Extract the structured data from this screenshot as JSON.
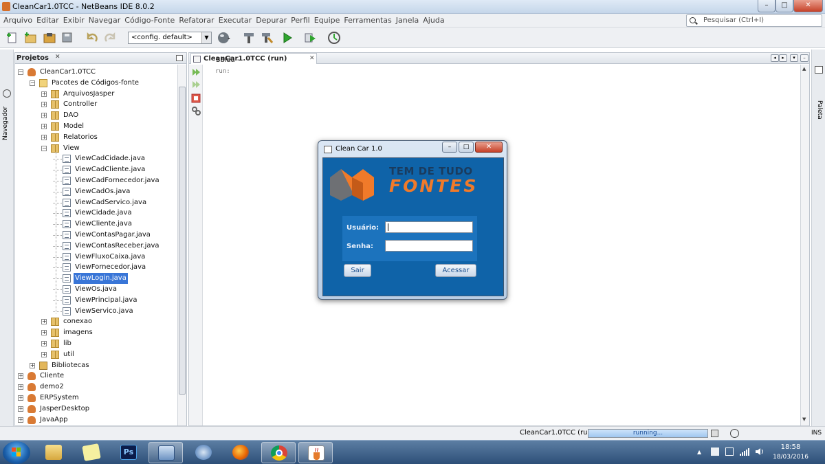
{
  "window": {
    "title": "CleanCar1.0TCC - NetBeans IDE 8.0.2",
    "controls": [
      "–",
      "□",
      "✕"
    ]
  },
  "menu": [
    "Arquivo",
    "Editar",
    "Exibir",
    "Navegar",
    "Código-Fonte",
    "Refatorar",
    "Executar",
    "Depurar",
    "Perfil",
    "Equipe",
    "Ferramentas",
    "Janela",
    "Ajuda"
  ],
  "search": {
    "placeholder": "Pesquisar (Ctrl+I)"
  },
  "toolbar": {
    "config_value": "<config. default>"
  },
  "left_strip": {
    "navegador_label": "Navegador"
  },
  "right_strip": {
    "paleta_label": "Paleta"
  },
  "projects_panel": {
    "tab_label": "Projetos",
    "tree": [
      {
        "label": "CleanCar1.0TCC",
        "icon": "project-icon",
        "expanded": true
      },
      {
        "label": "Pacotes de Códigos-fonte",
        "icon": "source-folder-icon",
        "expanded": true
      },
      {
        "label": "ArquivosJasper",
        "icon": "package-icon"
      },
      {
        "label": "Controller",
        "icon": "package-icon"
      },
      {
        "label": "DAO",
        "icon": "package-icon"
      },
      {
        "label": "Model",
        "icon": "package-icon"
      },
      {
        "label": "Relatorios",
        "icon": "package-icon"
      },
      {
        "label": "View",
        "icon": "package-icon",
        "expanded": true
      },
      {
        "label": "ViewCadCidade.java",
        "icon": "java-file-icon"
      },
      {
        "label": "ViewCadCliente.java",
        "icon": "java-file-icon"
      },
      {
        "label": "ViewCadFornecedor.java",
        "icon": "java-file-icon"
      },
      {
        "label": "ViewCadOs.java",
        "icon": "java-file-icon"
      },
      {
        "label": "ViewCadServico.java",
        "icon": "java-file-icon"
      },
      {
        "label": "ViewCidade.java",
        "icon": "java-file-icon"
      },
      {
        "label": "ViewCliente.java",
        "icon": "java-file-icon"
      },
      {
        "label": "ViewContasPagar.java",
        "icon": "java-file-icon"
      },
      {
        "label": "ViewContasReceber.java",
        "icon": "java-file-icon"
      },
      {
        "label": "ViewFluxoCaixa.java",
        "icon": "java-file-icon"
      },
      {
        "label": "ViewFornecedor.java",
        "icon": "java-file-icon"
      },
      {
        "label": "ViewLogin.java",
        "icon": "java-file-icon",
        "selected": true
      },
      {
        "label": "ViewOs.java",
        "icon": "java-file-icon"
      },
      {
        "label": "ViewPrincipal.java",
        "icon": "java-file-icon"
      },
      {
        "label": "ViewServico.java",
        "icon": "java-file-icon"
      },
      {
        "label": "conexao",
        "icon": "package-icon"
      },
      {
        "label": "imagens",
        "icon": "package-icon"
      },
      {
        "label": "lib",
        "icon": "package-icon"
      },
      {
        "label": "util",
        "icon": "package-icon"
      },
      {
        "label": "Bibliotecas",
        "icon": "library-icon"
      },
      {
        "label": "Cliente",
        "icon": "project-icon"
      },
      {
        "label": "demo2",
        "icon": "project-icon"
      },
      {
        "label": "ERPSystem",
        "icon": "project-icon"
      },
      {
        "label": "JasperDesktop",
        "icon": "project-icon"
      },
      {
        "label": "JavaApp",
        "icon": "project-icon"
      }
    ]
  },
  "output_panel": {
    "tab_prefix": "Saída - ",
    "tab_bold": "CleanCar1.0TCC (run)",
    "close": "✕",
    "output_text": "run:"
  },
  "dialog": {
    "title": "Clean Car 1.0",
    "logo_line1": "TEM DE TUDO",
    "logo_line2": "FONTES",
    "usuario_label": "Usuário:",
    "senha_label": "Senha:",
    "usuario_value": "",
    "senha_value": "",
    "sair_label": "Sair",
    "acessar_label": "Acessar",
    "close_glyph": "✕"
  },
  "status": {
    "project_run": "CleanCar1.0TCC (run)",
    "progress_text": "running...",
    "mode": "INS"
  },
  "taskbar": {
    "time": "18:58",
    "date": "18/03/2016"
  },
  "colors": {
    "dialog_body": "#0f63a8",
    "selection": "#3875d7",
    "logo_orange": "#f07a2a",
    "logo_gray": "#6e7074"
  }
}
